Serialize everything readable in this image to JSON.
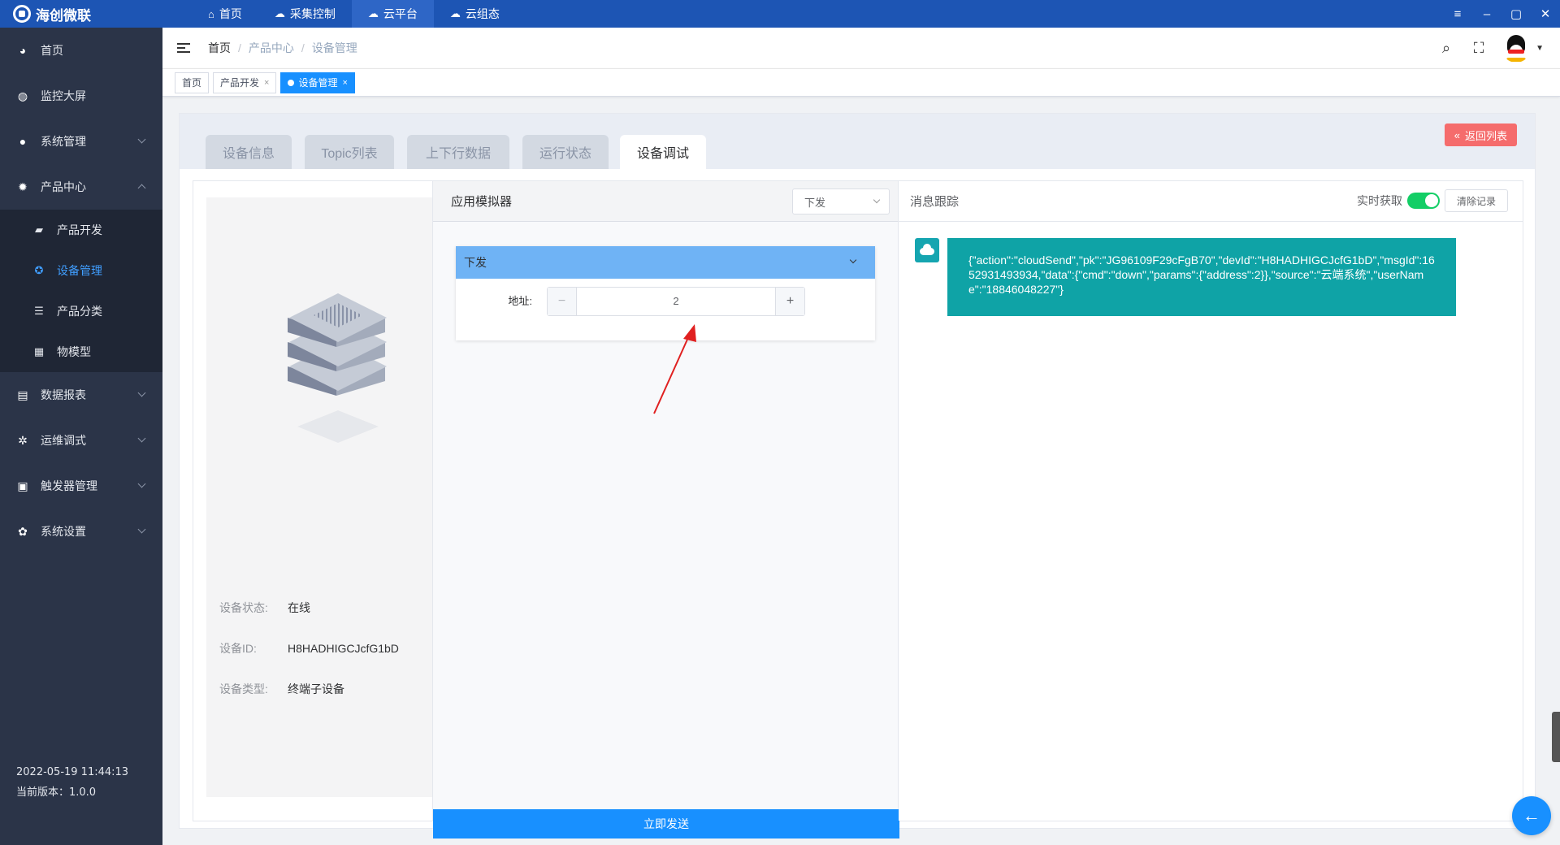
{
  "app": {
    "title": "海创微联"
  },
  "topnav": [
    {
      "label": "首页",
      "icon": "home-icon"
    },
    {
      "label": "采集控制",
      "icon": "cloud-gear-icon"
    },
    {
      "label": "云平台",
      "icon": "cloud-platform-icon"
    },
    {
      "label": "云组态",
      "icon": "cloud-config-icon"
    }
  ],
  "sidebar": {
    "items": [
      {
        "label": "首页"
      },
      {
        "label": "监控大屏"
      },
      {
        "label": "系统管理"
      },
      {
        "label": "产品中心"
      },
      {
        "label": "数据报表"
      },
      {
        "label": "运维调式"
      },
      {
        "label": "触发器管理"
      },
      {
        "label": "系统设置"
      }
    ],
    "submenu": [
      {
        "label": "产品开发"
      },
      {
        "label": "设备管理"
      },
      {
        "label": "产品分类"
      },
      {
        "label": "物模型"
      }
    ],
    "footer": {
      "datetime": "2022-05-19 11:44:13",
      "version": "当前版本：1.0.0"
    }
  },
  "breadcrumb": [
    "首页",
    "产品中心",
    "设备管理"
  ],
  "tags": [
    {
      "label": "首页"
    },
    {
      "label": "产品开发"
    },
    {
      "label": "设备管理"
    }
  ],
  "tabs": [
    "设备信息",
    "Topic列表",
    "上下行数据",
    "运行状态",
    "设备调试"
  ],
  "back_button": "返回列表",
  "device": {
    "status_label": "设备状态:",
    "status": "在线",
    "id_label": "设备ID:",
    "id": "H8HADHIGCJcfG1bD",
    "type_label": "设备类型:",
    "type": "终端子设备"
  },
  "simulator": {
    "title": "应用模拟器",
    "select_value": "下发",
    "card_title": "下发",
    "field_label": "地址:",
    "field_value": "2",
    "send_button": "立即发送"
  },
  "messages": {
    "title": "消息跟踪",
    "realtime_label": "实时获取",
    "realtime_on": true,
    "clear_button": "清除记录",
    "items": [
      {
        "text": "{\"action\":\"cloudSend\",\"pk\":\"JG96109F29cFgB70\",\"devId\":\"H8HADHIGCJcfG1bD\",\"msgId\":1652931493934,\"data\":{\"cmd\":\"down\",\"params\":{\"address\":2}},\"source\":\"云端系统\",\"userName\":\"18846048227\"}"
      }
    ]
  },
  "colors": {
    "topbar": "#1d55b4",
    "sidebar": "#2b3448",
    "accent": "#1890ff",
    "danger": "#f56c6c",
    "message": "#0fa3a6"
  }
}
